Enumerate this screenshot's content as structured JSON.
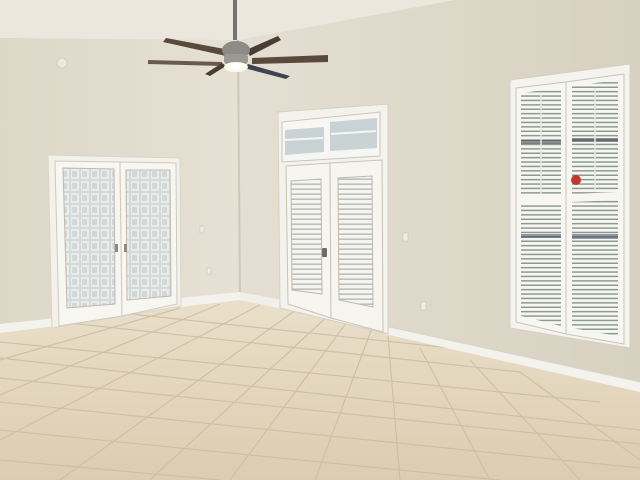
{
  "scene": {
    "subject": "empty-room-interior",
    "colors": {
      "left_wall": "#e2dccd",
      "right_wall": "#dcd6c7",
      "ceiling": "#eeeae0",
      "floor_tile": "#e3d6be",
      "grout": "#cfc1a6",
      "trim": "#f4f2ec",
      "glass": "#cfd6d6",
      "shutter": "#f2f2ee",
      "fan_blade": "#5a4a3e",
      "fan_metal": "#8d8b86"
    },
    "elements": [
      {
        "name": "french-doors-left",
        "kind": "glass-block double doors"
      },
      {
        "name": "french-door-right-with-transom",
        "kind": "door with shutter inserts and transom window"
      },
      {
        "name": "plantation-shutter-window",
        "kind": "window with plantation shutters"
      },
      {
        "name": "ceiling-fan",
        "kind": "ceiling fan with light"
      },
      {
        "name": "tile-floor",
        "kind": "beige ceramic tile floor"
      }
    ]
  }
}
